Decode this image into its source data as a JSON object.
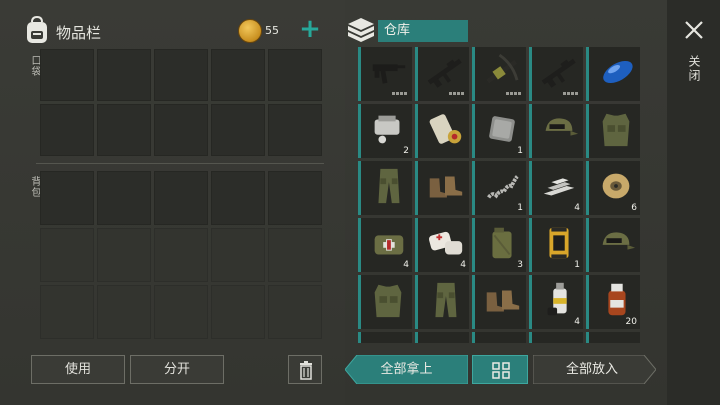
{
  "inventory": {
    "title": "物品栏",
    "coins": "55",
    "pockets_label": "口袋",
    "backpack_label": "背包",
    "use_label": "使用",
    "split_label": "分开"
  },
  "storage": {
    "title": "仓库",
    "take_all_label": "全部拿上",
    "put_all_label": "全部放入",
    "items": [
      {
        "icon": "smg-icon",
        "count": "",
        "durability": true
      },
      {
        "icon": "assault-rifle-icon",
        "count": "",
        "durability": true
      },
      {
        "icon": "crossbow-icon",
        "count": "",
        "durability": true
      },
      {
        "icon": "assault-rifle-icon",
        "count": "",
        "durability": true
      },
      {
        "icon": "blue-fuel-tank-icon",
        "count": "",
        "durability": false
      },
      {
        "icon": "engine-part-icon",
        "count": "2",
        "durability": false
      },
      {
        "icon": "map-scroll-icon",
        "count": "",
        "durability": false
      },
      {
        "icon": "metal-plate-icon",
        "count": "1",
        "durability": false
      },
      {
        "icon": "camo-cap-icon",
        "count": "",
        "durability": false
      },
      {
        "icon": "camo-vest-icon",
        "count": "",
        "durability": false
      },
      {
        "icon": "camo-pants-icon",
        "count": "",
        "durability": false
      },
      {
        "icon": "boots-icon",
        "count": "",
        "durability": false
      },
      {
        "icon": "spring-icon",
        "count": "1",
        "durability": false
      },
      {
        "icon": "iron-bars-icon",
        "count": "4",
        "durability": false
      },
      {
        "icon": "wire-spool-icon",
        "count": "6",
        "durability": false
      },
      {
        "icon": "medkit-bag-icon",
        "count": "4",
        "durability": false
      },
      {
        "icon": "bandage-icon",
        "count": "4",
        "durability": false
      },
      {
        "icon": "jerrycan-icon",
        "count": "3",
        "durability": false
      },
      {
        "icon": "oil-filter-icon",
        "count": "1",
        "durability": false
      },
      {
        "icon": "camo-cap-icon",
        "count": "",
        "durability": false
      },
      {
        "icon": "camo-vest-icon",
        "count": "",
        "durability": false
      },
      {
        "icon": "camo-pants-icon",
        "count": "",
        "durability": false
      },
      {
        "icon": "boots-icon",
        "count": "",
        "durability": false
      },
      {
        "icon": "spray-paint-icon",
        "count": "4",
        "durability": false
      },
      {
        "icon": "medicine-bottle-icon",
        "count": "20",
        "durability": false
      },
      {
        "icon": "partial-item-icon",
        "count": "",
        "durability": false
      },
      {
        "icon": "partial-item-icon",
        "count": "",
        "durability": false
      },
      {
        "icon": "partial-item-icon",
        "count": "",
        "durability": false
      },
      {
        "icon": "partial-item-icon",
        "count": "",
        "durability": false
      },
      {
        "icon": "partial-item-icon",
        "count": "",
        "durability": false
      }
    ]
  },
  "close_label": "关闭",
  "colors": {
    "accent": "#2b7f7a",
    "accent_light": "#3ea79f",
    "coin": "#e0a92e",
    "plus": "#27a89a"
  }
}
